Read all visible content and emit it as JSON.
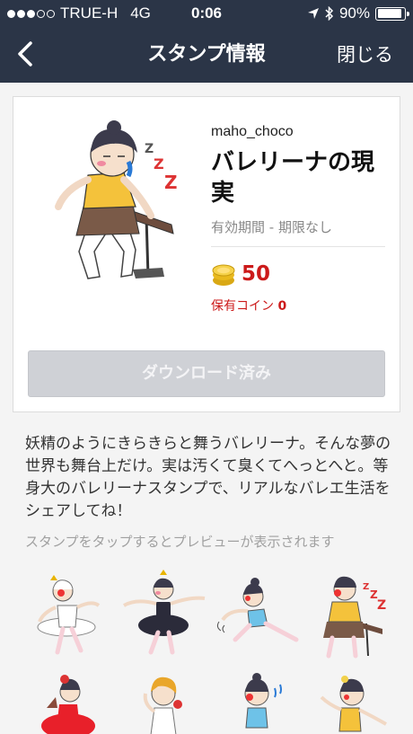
{
  "status_bar": {
    "carrier": "TRUE-H",
    "network": "4G",
    "time": "0:06",
    "battery": "90%",
    "battery_level": 0.9
  },
  "nav": {
    "title": "スタンプ情報",
    "close_label": "閉じる"
  },
  "package": {
    "creator": "maho_choco",
    "title": "バレリーナの現実",
    "validity": "有効期間 - 期限なし",
    "price": "50",
    "owned_coins_label": "保有コイン",
    "owned_coins_value": "0",
    "download_label": "ダウンロード済み"
  },
  "description": "妖精のようにきらきらと舞うバレリーナ。そんな夢の世界も舞台上だけ。実は汚くて臭くてへっとへと。等身大のバレリーナスタンプで、リアルなバレエ生活をシェアしてね！",
  "preview_hint": "スタンプをタップするとプレビューが表示されます",
  "colors": {
    "navbar": "#2b3547",
    "price_red": "#cc1a1a",
    "button_disabled": "#cfd1d6"
  },
  "stickers": [
    {
      "icon": "ballerina-white-tutu-sticker"
    },
    {
      "icon": "ballerina-black-tutu-sticker"
    },
    {
      "icon": "ballerina-stretch-blue-sticker"
    },
    {
      "icon": "ballerina-sleeping-barre-sticker"
    },
    {
      "icon": "ballerina-red-dress-fan-sticker"
    },
    {
      "icon": "ballerina-blonde-flower-sticker"
    },
    {
      "icon": "ballerina-crying-blue-sticker"
    },
    {
      "icon": "ballerina-yellow-dance-sticker"
    }
  ]
}
